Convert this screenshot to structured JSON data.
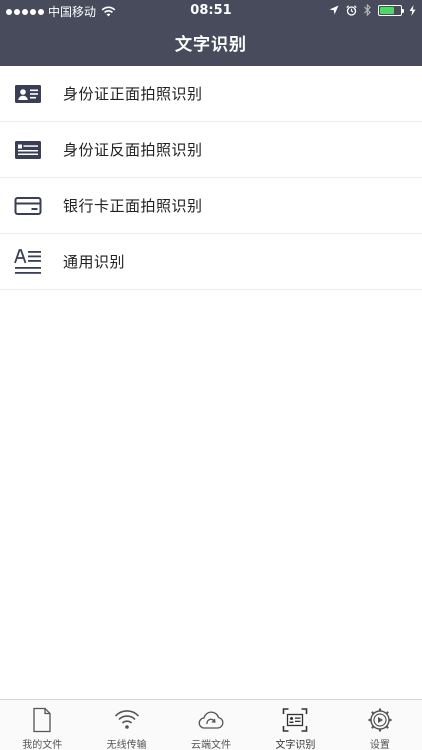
{
  "status_bar": {
    "carrier": "中国移动",
    "time": "08:51"
  },
  "header": {
    "title": "文字识别"
  },
  "menu": {
    "items": [
      {
        "label": "身份证正面拍照识别",
        "icon": "id-card-front-icon"
      },
      {
        "label": "身份证反面拍照识别",
        "icon": "id-card-back-icon"
      },
      {
        "label": "银行卡正面拍照识别",
        "icon": "bank-card-icon"
      },
      {
        "label": "通用识别",
        "icon": "text-recognition-icon"
      }
    ]
  },
  "tabbar": {
    "tabs": [
      {
        "label": "我的文件",
        "icon": "file-icon"
      },
      {
        "label": "无线传输",
        "icon": "wifi-icon"
      },
      {
        "label": "云端文件",
        "icon": "cloud-sync-icon"
      },
      {
        "label": "文字识别",
        "icon": "scan-card-icon",
        "active": true
      },
      {
        "label": "设置",
        "icon": "gear-icon"
      }
    ]
  },
  "colors": {
    "header_bg": "#474b5c",
    "icon_dark": "#3a3f55",
    "battery_green": "#4cd964"
  }
}
